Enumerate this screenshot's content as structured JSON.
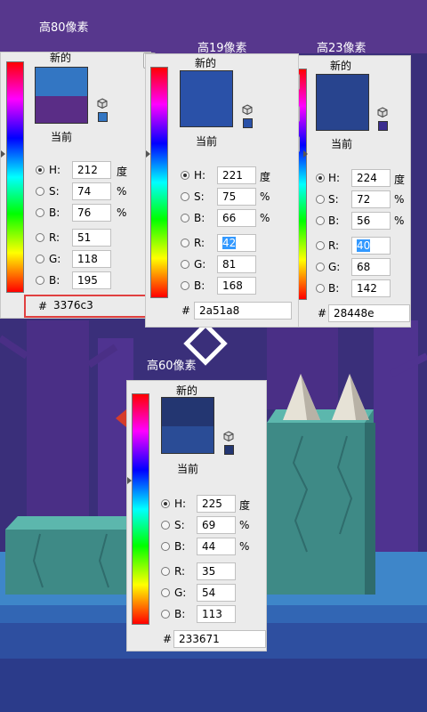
{
  "colors": {
    "bg_top": "#3a2f7a",
    "ground_light": "#3e86c9",
    "ground_dark": "#2b3b8a",
    "tree": "#4a2f86",
    "rock": "#4aa39a",
    "hue_top": "#ff0000",
    "selection": "#3399ff",
    "highlight_box": "#e04040"
  },
  "pickers": [
    {
      "outer_label": "高80像素",
      "new_label": "新的",
      "current_label": "当前",
      "new_color": "#3376c3",
      "current_color": "#5a2d86",
      "mini_swatch_color": "#3376c3",
      "H": {
        "label": "H:",
        "value": "212",
        "unit": "度"
      },
      "S": {
        "label": "S:",
        "value": "74",
        "unit": "%"
      },
      "B": {
        "label": "B:",
        "value": "76",
        "unit": "%"
      },
      "R": {
        "label": "R:",
        "value": "51"
      },
      "G": {
        "label": "G:",
        "value": "118"
      },
      "Bl": {
        "label": "B:",
        "value": "195"
      },
      "hex": {
        "hash": "#",
        "value": "3376c3"
      }
    },
    {
      "outer_label": "高19像素",
      "new_label": "新的",
      "current_label": "当前",
      "new_color": "#2a51a8",
      "current_color": "#2a51a8",
      "mini_swatch_color": "#2a51a8",
      "H": {
        "label": "H:",
        "value": "221",
        "unit": "度"
      },
      "S": {
        "label": "S:",
        "value": "75",
        "unit": "%"
      },
      "B": {
        "label": "B:",
        "value": "66",
        "unit": "%"
      },
      "R": {
        "label": "R:",
        "value": "42"
      },
      "G": {
        "label": "G:",
        "value": "81"
      },
      "Bl": {
        "label": "B:",
        "value": "168"
      },
      "hex": {
        "hash": "#",
        "value": "2a51a8"
      }
    },
    {
      "outer_label": "高23像素",
      "new_label": "新的",
      "current_label": "当前",
      "new_color": "#28448e",
      "current_color": "#28448e",
      "mini_swatch_color": "#3b2d8f",
      "H": {
        "label": "H:",
        "value": "224",
        "unit": "度"
      },
      "S": {
        "label": "S:",
        "value": "72",
        "unit": "%"
      },
      "B": {
        "label": "B:",
        "value": "56",
        "unit": "%"
      },
      "R": {
        "label": "R:",
        "value": "40"
      },
      "G": {
        "label": "G:",
        "value": "68"
      },
      "Bl": {
        "label": "B:",
        "value": "142"
      },
      "hex": {
        "hash": "#",
        "value": "28448e"
      }
    },
    {
      "outer_label": "高60像素",
      "new_label": "新的",
      "current_label": "当前",
      "new_color": "#233671",
      "current_color": "#2a4c96",
      "mini_swatch_color": "#233671",
      "H": {
        "label": "H:",
        "value": "225",
        "unit": "度"
      },
      "S": {
        "label": "S:",
        "value": "69",
        "unit": "%"
      },
      "B": {
        "label": "B:",
        "value": "44",
        "unit": "%"
      },
      "R": {
        "label": "R:",
        "value": "35"
      },
      "G": {
        "label": "G:",
        "value": "54"
      },
      "Bl": {
        "label": "B:",
        "value": "113"
      },
      "hex": {
        "hash": "#",
        "value": "233671"
      }
    }
  ]
}
